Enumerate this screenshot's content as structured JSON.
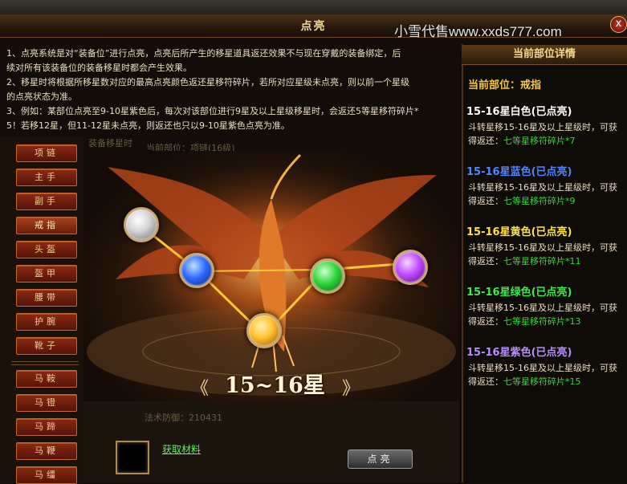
{
  "window": {
    "title": "点亮",
    "watermark": "小雪代售www.xxds777.com",
    "close_label": "x"
  },
  "description": [
    "1、点亮系统是对“装备位”进行点亮，点亮后所产生的移星道具返还效果不与现在穿戴的装备绑定，后",
    "续对所有该装备位的装备移星时都会产生效果。",
    "2、移星时将根据所移星数对应的最高点亮颜色返还星移符碎片，若所对应星级未点亮，则以前一个星级",
    "的点亮状态为准。",
    "3、例如：某部位点亮至9-10星紫色后，每次对该部位进行9星及以上星级移星时，会返还5等星移符碎片*",
    "5！若移12星，但11-12星未点亮，则返还也只以9-10星紫色点亮为准。"
  ],
  "background_ghost": {
    "subtitle": "装备移星时",
    "position": "当前部位：项链(16级)",
    "magic_defense": "法术防御：210431"
  },
  "categories": [
    {
      "label": "项链"
    },
    {
      "label": "主手"
    },
    {
      "label": "副手"
    },
    {
      "label": "戒指",
      "active": true
    },
    {
      "label": "头盔"
    },
    {
      "label": "盔甲"
    },
    {
      "label": "腰带"
    },
    {
      "label": "护腕"
    },
    {
      "label": "靴子"
    },
    {
      "label": "马鞍"
    },
    {
      "label": "马镫"
    },
    {
      "label": "马蹄"
    },
    {
      "label": "马鞭"
    },
    {
      "label": "马缰"
    }
  ],
  "scene": {
    "star_range": "15~16星",
    "left_arrow": "《",
    "right_arrow": "》",
    "orbs": [
      {
        "name": "white",
        "color": "#ffffff"
      },
      {
        "name": "blue",
        "color": "#2f6bff"
      },
      {
        "name": "yellow",
        "color": "#ffbf2f"
      },
      {
        "name": "green",
        "color": "#2fd63a"
      },
      {
        "name": "purple",
        "color": "#c04bff"
      }
    ]
  },
  "footer": {
    "get_material": "获取材料",
    "light_button": "点亮"
  },
  "right_panel": {
    "header": "当前部位详情",
    "current_part": "当前部位：戒指",
    "tiers": [
      {
        "title": "15-16星白色(已点亮)",
        "color": "#ffffff",
        "line1": "斗转星移15-16星及以上星级时，可获",
        "line2_prefix": "得返还：",
        "reward": "七等星移符碎片*7"
      },
      {
        "title": "15-16星蓝色(已点亮)",
        "color": "#4f86ff",
        "line1": "斗转星移15-16星及以上星级时，可获",
        "line2_prefix": "得返还：",
        "reward": "七等星移符碎片*9"
      },
      {
        "title": "15-16星黄色(已点亮)",
        "color": "#ffe33a",
        "line1": "斗转星移15-16星及以上星级时，可获",
        "line2_prefix": "得返还：",
        "reward": "七等星移符碎片*11"
      },
      {
        "title": "15-16星绿色(已点亮)",
        "color": "#3ee94a",
        "line1": "斗转星移15-16星及以上星级时，可获",
        "line2_prefix": "得返还：",
        "reward": "七等星移符碎片*13"
      },
      {
        "title": "15-16星紫色(已点亮)",
        "color": "#b78cff",
        "line1": "斗转星移15-16星及以上星级时，可获",
        "line2_prefix": "得返还：",
        "reward": "七等星移符碎片*15"
      }
    ]
  }
}
